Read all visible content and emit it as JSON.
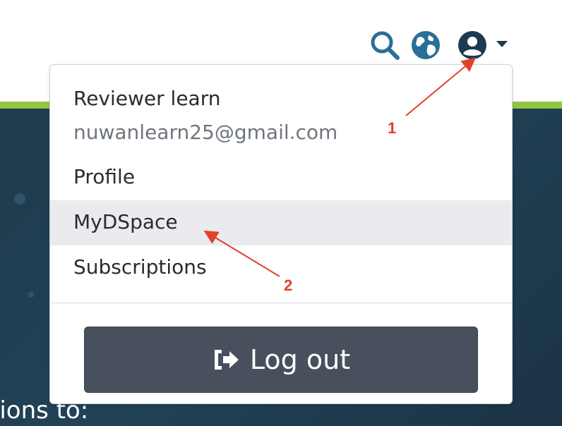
{
  "nav": {
    "icons": [
      "search-icon",
      "globe-icon",
      "user-icon",
      "caret-down-icon"
    ],
    "accent_color": "#2a6f97"
  },
  "user_menu": {
    "name": "Reviewer learn",
    "email": "nuwanlearn25@gmail.com",
    "items": [
      {
        "label": "Profile"
      },
      {
        "label": "MyDSpace",
        "highlighted": true
      },
      {
        "label": "Subscriptions"
      }
    ],
    "logout_label": "Log out",
    "logout_icon": "sign-out-icon"
  },
  "annotations": {
    "marker_1": "1",
    "marker_2": "2",
    "color": "#e0412b"
  },
  "banner": {
    "partial_text": "tions to:"
  },
  "colors": {
    "green_strip": "#92c642",
    "banner_bg": "#1f3b4d",
    "logout_bg": "#47505c",
    "highlight_bg": "#e9ebee"
  }
}
